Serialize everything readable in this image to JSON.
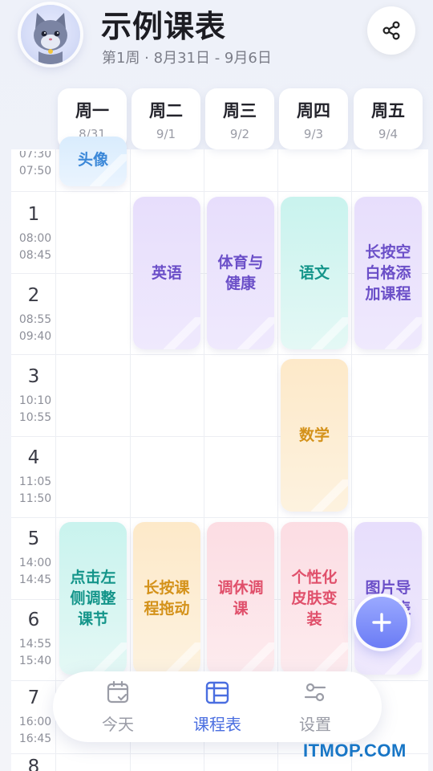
{
  "header": {
    "title": "示例课表",
    "subtitle": "第1周 · 8月31日 - 9月6日"
  },
  "days": [
    {
      "name": "周一",
      "date": "8/31"
    },
    {
      "name": "周二",
      "date": "9/1"
    },
    {
      "name": "周三",
      "date": "9/2"
    },
    {
      "name": "周四",
      "date": "9/3"
    },
    {
      "name": "周五",
      "date": "9/4"
    }
  ],
  "slots": {
    "partial_top_time": "07:30",
    "partial_top_end": "07:50",
    "items": [
      {
        "num": "1",
        "start": "08:00",
        "end": "08:45"
      },
      {
        "num": "2",
        "start": "08:55",
        "end": "09:40"
      },
      {
        "num": "3",
        "start": "10:10",
        "end": "10:55"
      },
      {
        "num": "4",
        "start": "11:05",
        "end": "11:50"
      },
      {
        "num": "5",
        "start": "14:00",
        "end": "14:45"
      },
      {
        "num": "6",
        "start": "14:55",
        "end": "15:40"
      },
      {
        "num": "7",
        "start": "16:00",
        "end": "16:45"
      },
      {
        "num": "8"
      }
    ]
  },
  "courses": {
    "mon_top": "头像",
    "tue_12": "英语",
    "wed_12": "体育与健康",
    "thu_12": "语文",
    "fri_12": "长按空白格添加课程",
    "thu_34": "数学",
    "mon_56": "点击左侧调整课节",
    "tue_56": "长按课程拖动",
    "wed_56": "调休调课",
    "thu_56": "个性化皮肤变装",
    "fri_56": "图片导入课表"
  },
  "tabbar": {
    "today": "今天",
    "schedule": "课程表",
    "settings": "设置",
    "active_color": "#4a6ee0",
    "inactive_color": "#9a9ca6"
  },
  "watermark": "ITMOP.COM",
  "icons": {
    "share": "share-icon",
    "add": "plus-icon",
    "today": "calendar-check-icon",
    "schedule": "table-icon",
    "settings": "sliders-icon"
  }
}
